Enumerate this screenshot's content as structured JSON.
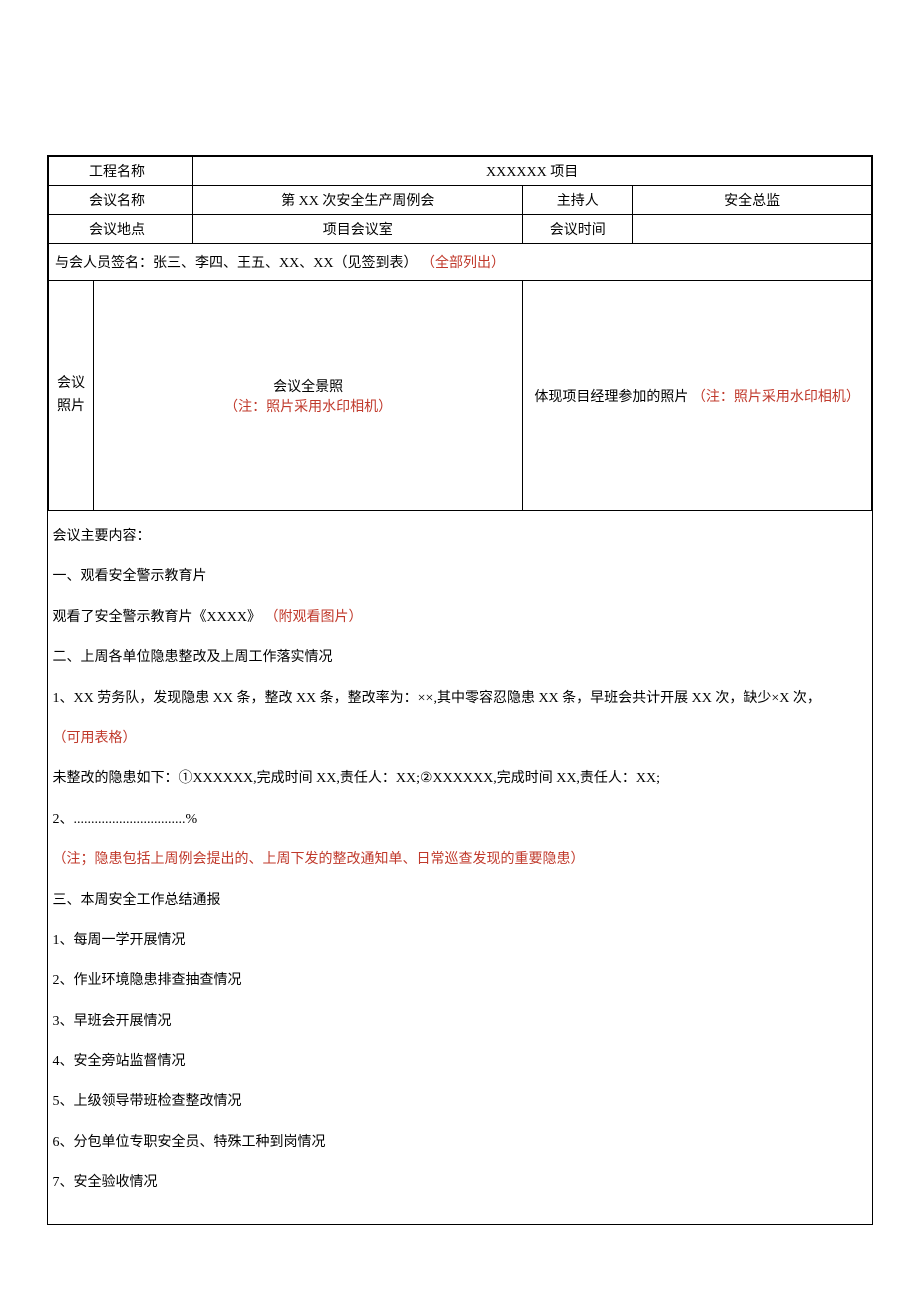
{
  "header": {
    "proj_label": "工程名称",
    "proj_value": "XXXXXX 项目",
    "meet_label": "会议名称",
    "meet_value": "第 XX 次安全生产周例会",
    "host_label": "主持人",
    "host_value": "安全总监",
    "loc_label": "会议地点",
    "loc_value": "项目会议室",
    "time_label": "会议时间",
    "time_value": ""
  },
  "attendees": {
    "prefix": "与会人员签名：张三、李四、王五、XX、XX（见签到表）",
    "note": "（全部列出）"
  },
  "photos": {
    "label1": "会议",
    "label2": "照片",
    "left_title": "会议全景照",
    "left_note": "（注：照片采用水印相机）",
    "right_title": "体现项目经理参加的照片",
    "right_note": "（注：照片采用水印相机）"
  },
  "content": {
    "title": "会议主要内容：",
    "s1": "一、观看安全警示教育片",
    "s1_body_a": "观看了安全警示教育片《XXXX》",
    "s1_body_b": "（附观看图片）",
    "s2": "二、上周各单位隐患整改及上周工作落实情况",
    "s2_body1": "1、XX 劳务队，发现隐患 XX 条，整改 XX 条，整改率为：××,其中零容忍隐患 XX 条，早班会共计开展 XX 次，缺少×X 次，",
    "s2_body1_note": "（可用表格）",
    "s2_body2": "未整改的隐患如下：①XXXXXX,完成时间 XX,责任人：XX;②XXXXXX,完成时间 XX,责任人：XX;",
    "s2_body3": "2、................................%",
    "s2_note": "（注；隐患包括上周例会提出的、上周下发的整改通知单、日常巡查发现的重要隐患）",
    "s3": "三、本周安全工作总结通报",
    "s3_1": "1、每周一学开展情况",
    "s3_2": "2、作业环境隐患排查抽查情况",
    "s3_3": "3、早班会开展情况",
    "s3_4": "4、安全旁站监督情况",
    "s3_5": "5、上级领导带班检查整改情况",
    "s3_6": "6、分包单位专职安全员、特殊工种到岗情况",
    "s3_7": "7、安全验收情况"
  }
}
